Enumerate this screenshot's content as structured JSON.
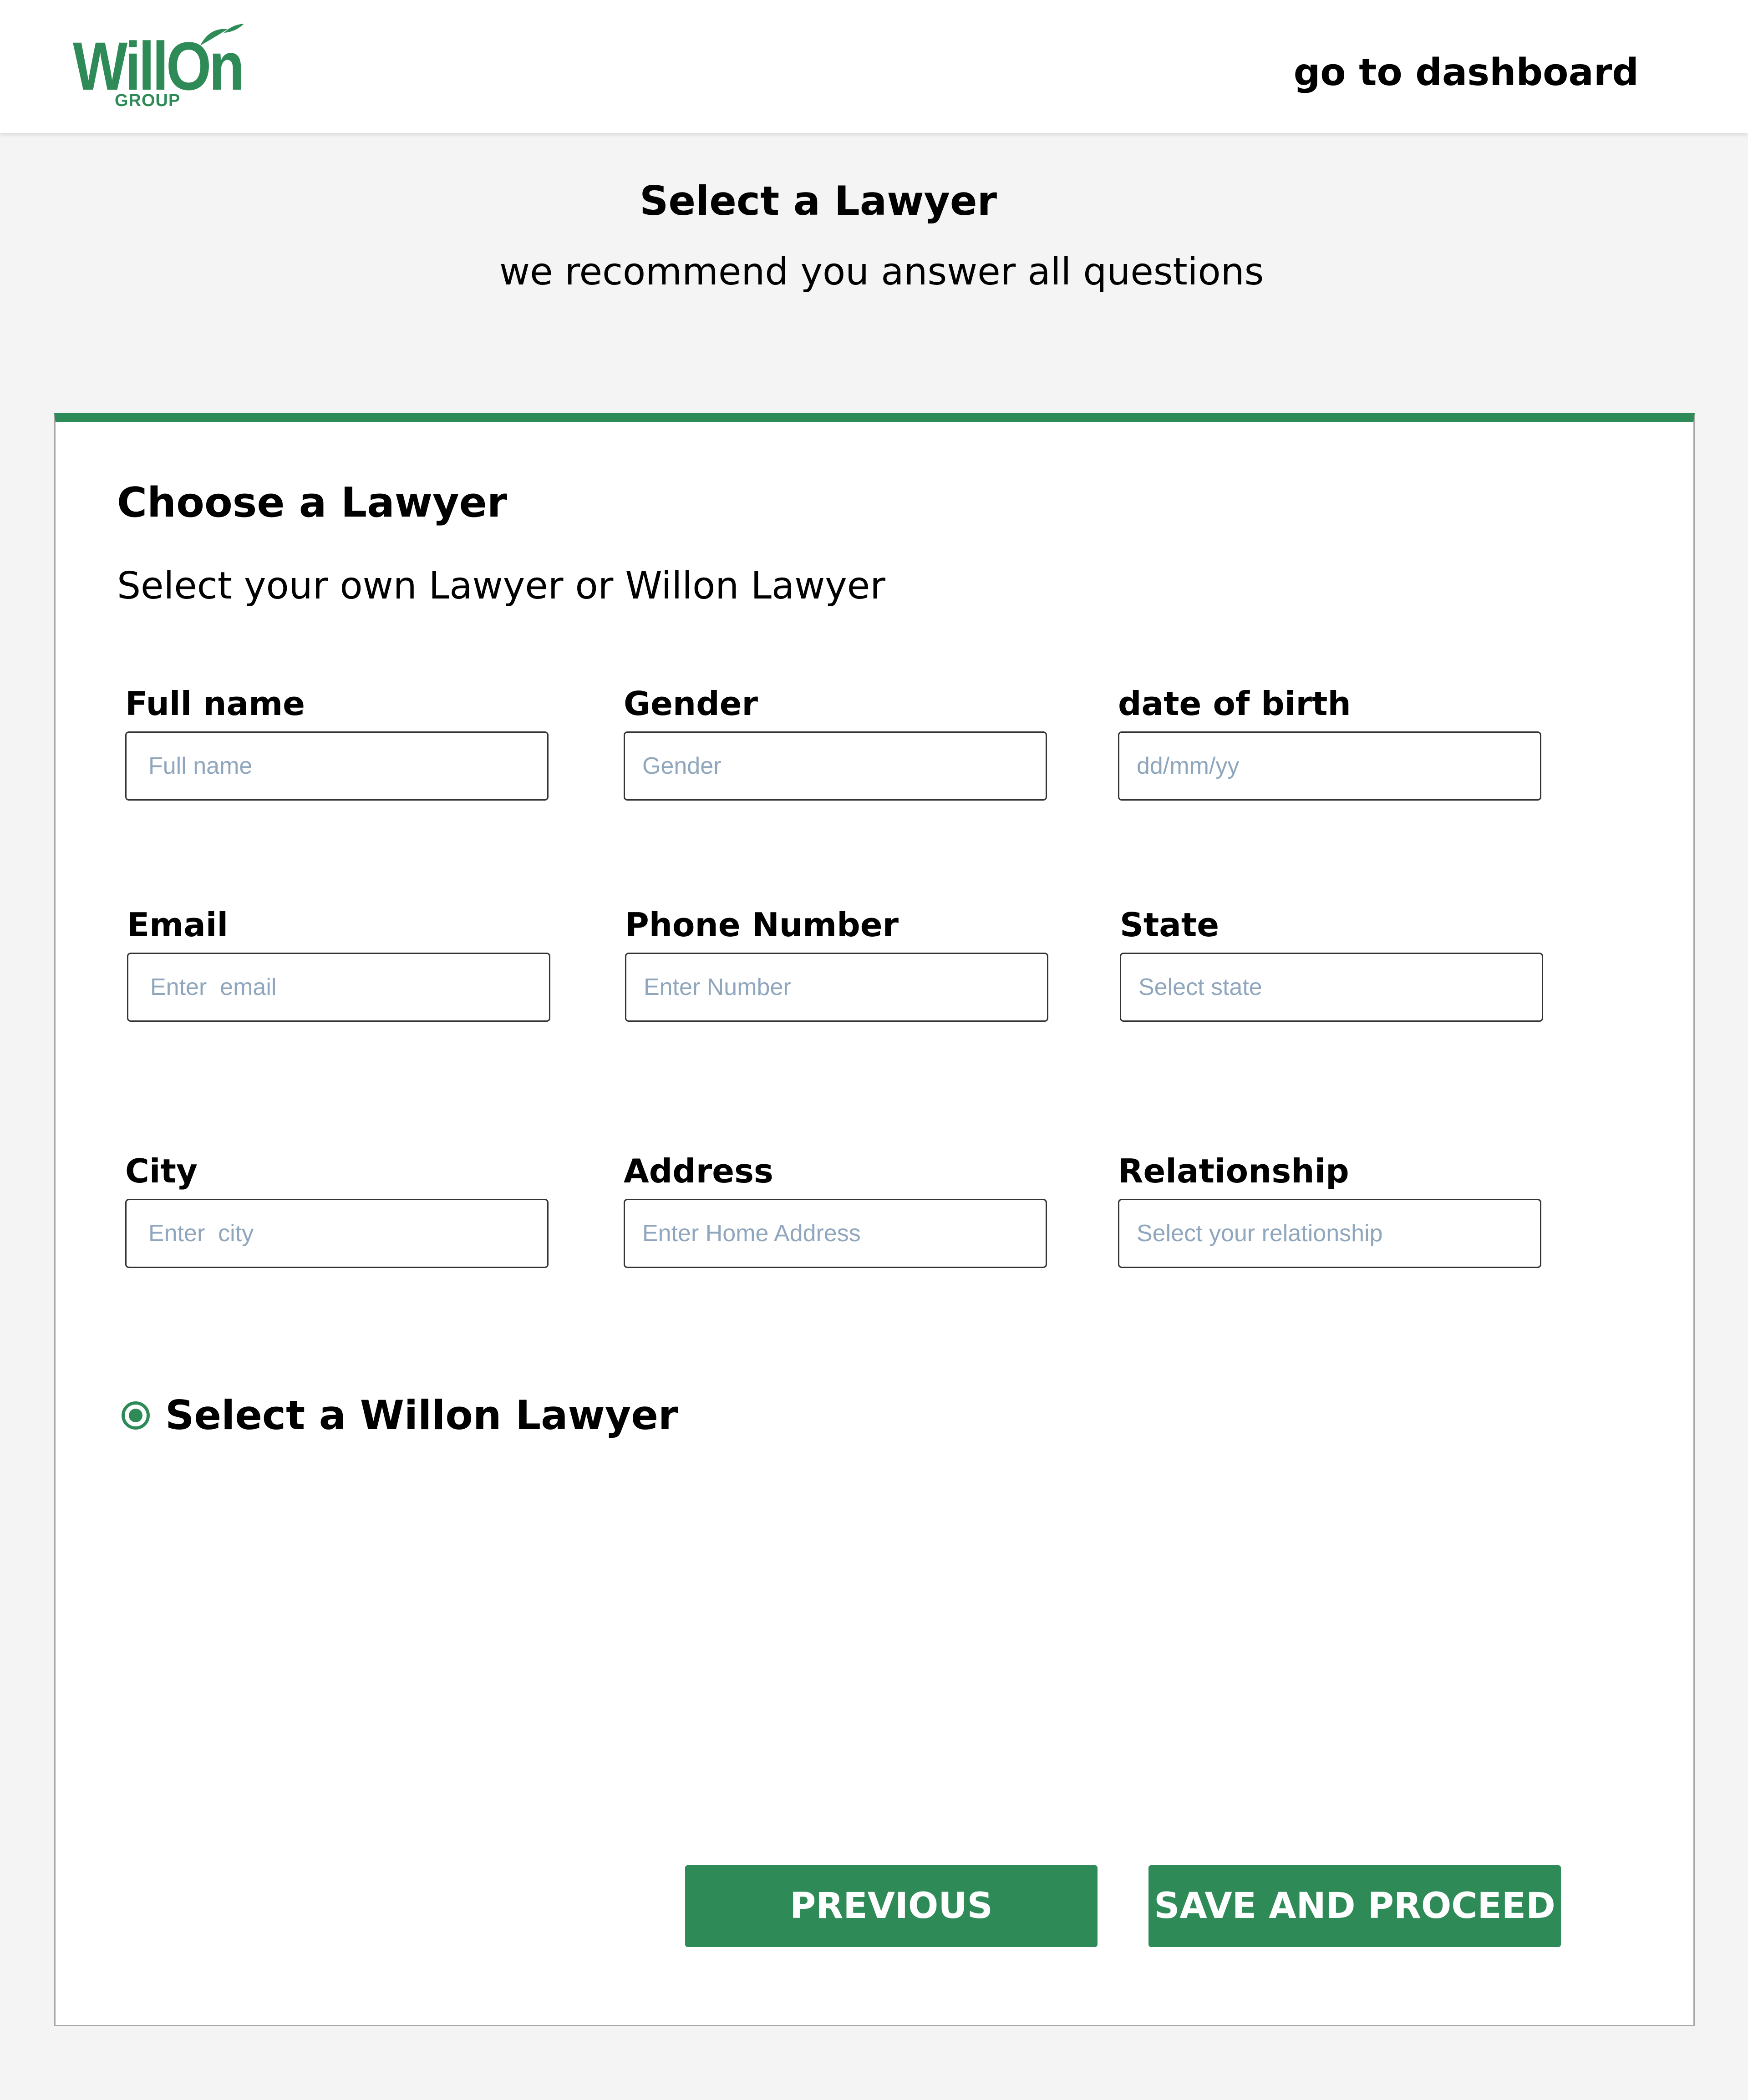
{
  "header": {
    "logo": {
      "wordmark": "WillOn",
      "sub": "GROUP"
    },
    "dashboard_link": "go to dashboard"
  },
  "page": {
    "title": "Select a Lawyer",
    "subtitle": "we recommend you answer all questions"
  },
  "card": {
    "title": "Choose a Lawyer",
    "subtitle": "Select your own Lawyer or Willon Lawyer",
    "fields": [
      {
        "label": "Full name",
        "placeholder": "Full name",
        "value": ""
      },
      {
        "label": "Gender",
        "placeholder": "Gender",
        "value": ""
      },
      {
        "label": "date of birth",
        "placeholder": "dd/mm/yy",
        "value": ""
      },
      {
        "label": "Email",
        "placeholder": "Enter  email",
        "value": ""
      },
      {
        "label": "Phone Number",
        "placeholder": "Enter Number",
        "value": ""
      },
      {
        "label": "State",
        "placeholder": "Select state",
        "value": ""
      },
      {
        "label": "City",
        "placeholder": "Enter  city",
        "value": ""
      },
      {
        "label": "Address",
        "placeholder": "Enter Home Address",
        "value": ""
      },
      {
        "label": "Relationship",
        "placeholder": "Select your relationship",
        "value": ""
      }
    ],
    "willon_option": {
      "label": "Select a Willon Lawyer",
      "selected": true
    },
    "buttons": {
      "previous": "PREVIOUS",
      "save": "SAVE AND PROCEED"
    }
  },
  "colors": {
    "brand_green": "#2e8b57",
    "background": "#f4f4f4",
    "placeholder": "#8fa6bd"
  }
}
